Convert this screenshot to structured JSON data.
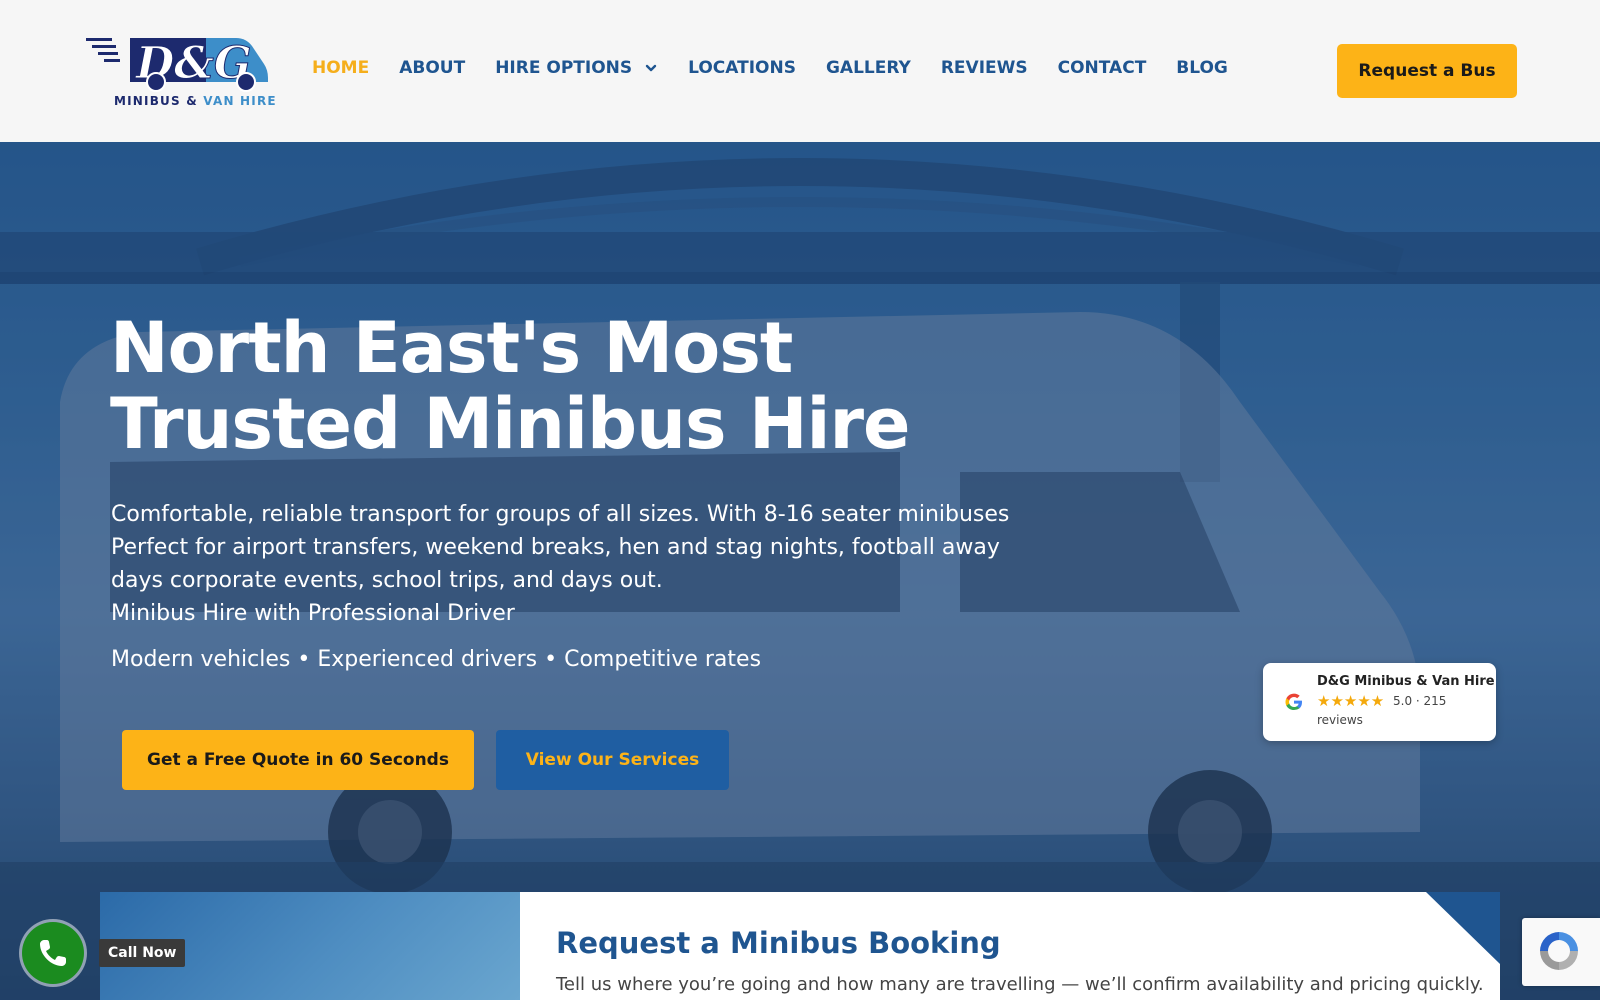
{
  "brand": {
    "logo_mark": "D&G",
    "tagline_part1": "MINIBUS &",
    "tagline_part2": "VAN HIRE"
  },
  "nav": {
    "items": [
      {
        "label": "HOME",
        "active": true
      },
      {
        "label": "ABOUT"
      },
      {
        "label": "HIRE OPTIONS",
        "dropdown": true
      },
      {
        "label": "LOCATIONS"
      },
      {
        "label": "GALLERY"
      },
      {
        "label": "REVIEWS"
      },
      {
        "label": "CONTACT"
      },
      {
        "label": "BLOG"
      }
    ],
    "cta_label": "Request a Bus"
  },
  "hero": {
    "title_line1": "North East's Most",
    "title_line2": "Trusted Minibus Hire",
    "desc_line1": "Comfortable, reliable transport for groups of all sizes. With 8-16 seater minibuses",
    "desc_line2": "Perfect for airport transfers, weekend breaks, hen and stag nights, football away",
    "desc_line3": "days corporate events, school trips, and days out.",
    "desc_line4": "Minibus Hire with Professional Driver",
    "features": "Modern vehicles • Experienced drivers • Competitive rates",
    "primary_cta": "Get a Free Quote in 60 Seconds",
    "secondary_cta": "View Our Services"
  },
  "review_badge": {
    "name": "D&G Minibus & Van Hire",
    "stars": "★★★★★",
    "rating_text": "5.0 · 215",
    "reviews_word": "reviews"
  },
  "booking": {
    "title": "Request a Minibus Booking",
    "subtitle": "Tell us where you’re going and how many are travelling — we’ll confirm availability and pricing quickly."
  },
  "call": {
    "label": "Call Now"
  },
  "colors": {
    "accent_yellow": "#fdb317",
    "brand_blue": "#1f5590",
    "call_green": "#1b8b1f"
  }
}
